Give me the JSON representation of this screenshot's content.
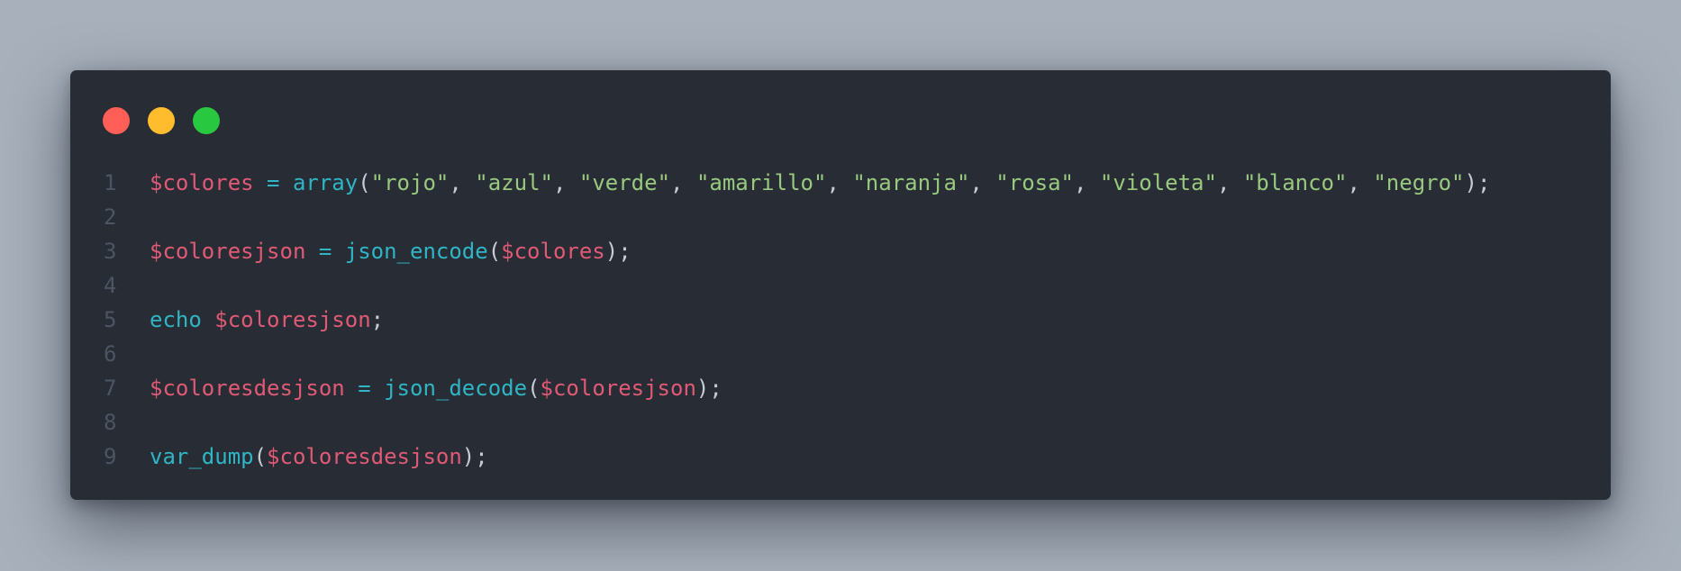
{
  "window": {
    "controls": [
      {
        "name": "close",
        "color": "#ff5f57"
      },
      {
        "name": "minimize",
        "color": "#ffbd2e"
      },
      {
        "name": "maximize",
        "color": "#28c940"
      }
    ]
  },
  "code": {
    "language": "php",
    "lines": [
      {
        "number": "1",
        "tokens": [
          {
            "t": "var",
            "v": "$colores"
          },
          {
            "t": "pun",
            "v": " "
          },
          {
            "t": "op",
            "v": "="
          },
          {
            "t": "pun",
            "v": " "
          },
          {
            "t": "fn",
            "v": "array"
          },
          {
            "t": "pun",
            "v": "("
          },
          {
            "t": "str",
            "v": "\"rojo\""
          },
          {
            "t": "pun",
            "v": ", "
          },
          {
            "t": "str",
            "v": "\"azul\""
          },
          {
            "t": "pun",
            "v": ", "
          },
          {
            "t": "str",
            "v": "\"verde\""
          },
          {
            "t": "pun",
            "v": ", "
          },
          {
            "t": "str",
            "v": "\"amarillo\""
          },
          {
            "t": "pun",
            "v": ", "
          },
          {
            "t": "str",
            "v": "\"naranja\""
          },
          {
            "t": "pun",
            "v": ", "
          },
          {
            "t": "str",
            "v": "\"rosa\""
          },
          {
            "t": "pun",
            "v": ", "
          },
          {
            "t": "str",
            "v": "\"violeta\""
          },
          {
            "t": "pun",
            "v": ", "
          },
          {
            "t": "str",
            "v": "\"blanco\""
          },
          {
            "t": "pun",
            "v": ", "
          },
          {
            "t": "str",
            "v": "\"negro\""
          },
          {
            "t": "pun",
            "v": ");"
          }
        ]
      },
      {
        "number": "2",
        "tokens": []
      },
      {
        "number": "3",
        "tokens": [
          {
            "t": "var",
            "v": "$coloresjson"
          },
          {
            "t": "pun",
            "v": " "
          },
          {
            "t": "op",
            "v": "="
          },
          {
            "t": "pun",
            "v": " "
          },
          {
            "t": "fn",
            "v": "json_encode"
          },
          {
            "t": "pun",
            "v": "("
          },
          {
            "t": "var",
            "v": "$colores"
          },
          {
            "t": "pun",
            "v": ");"
          }
        ]
      },
      {
        "number": "4",
        "tokens": []
      },
      {
        "number": "5",
        "tokens": [
          {
            "t": "fn",
            "v": "echo"
          },
          {
            "t": "pun",
            "v": " "
          },
          {
            "t": "var",
            "v": "$coloresjson"
          },
          {
            "t": "pun",
            "v": ";"
          }
        ]
      },
      {
        "number": "6",
        "tokens": []
      },
      {
        "number": "7",
        "tokens": [
          {
            "t": "var",
            "v": "$coloresdesjson"
          },
          {
            "t": "pun",
            "v": " "
          },
          {
            "t": "op",
            "v": "="
          },
          {
            "t": "pun",
            "v": " "
          },
          {
            "t": "fn",
            "v": "json_decode"
          },
          {
            "t": "pun",
            "v": "("
          },
          {
            "t": "var",
            "v": "$coloresjson"
          },
          {
            "t": "pun",
            "v": ");"
          }
        ]
      },
      {
        "number": "8",
        "tokens": []
      },
      {
        "number": "9",
        "tokens": [
          {
            "t": "fn",
            "v": "var_dump"
          },
          {
            "t": "pun",
            "v": "("
          },
          {
            "t": "var",
            "v": "$coloresdesjson"
          },
          {
            "t": "pun",
            "v": ");"
          }
        ]
      }
    ]
  },
  "colors": {
    "background": "#a7b0bb",
    "editor_background": "#282c35",
    "line_number": "#4d5563",
    "variable": "#e05a75",
    "function": "#2fb5c4",
    "string": "#98c97e",
    "punctuation": "#c7ccd4"
  }
}
